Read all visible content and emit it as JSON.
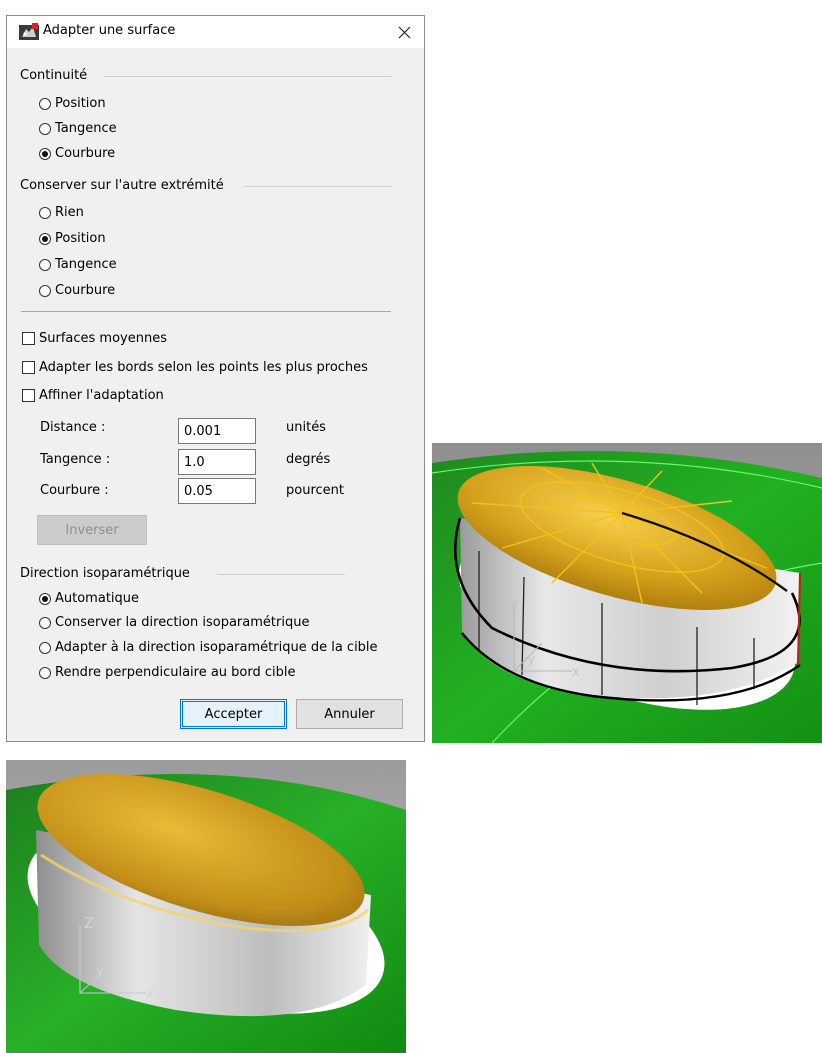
{
  "dialog": {
    "title": "Adapter une surface",
    "icon": "rhino-icon",
    "close_icon": "close-icon",
    "continuity": {
      "label": "Continuité",
      "options": [
        {
          "label": "Position",
          "selected": false
        },
        {
          "label": "Tangence",
          "selected": false
        },
        {
          "label": "Courbure",
          "selected": true
        }
      ]
    },
    "preserve": {
      "label": "Conserver sur l'autre extrémité",
      "options": [
        {
          "label": "Rien",
          "selected": false
        },
        {
          "label": "Position",
          "selected": true
        },
        {
          "label": "Tangence",
          "selected": false
        },
        {
          "label": "Courbure",
          "selected": false
        }
      ]
    },
    "checkboxes": [
      {
        "label": "Surfaces moyennes",
        "checked": false
      },
      {
        "label": "Adapter les bords selon les points les plus proches",
        "checked": false
      },
      {
        "label": "Affiner l'adaptation",
        "checked": false
      }
    ],
    "fields": [
      {
        "label": "Distance :",
        "value": "0.001",
        "unit": "unités"
      },
      {
        "label": "Tangence :",
        "value": "1.0",
        "unit": "degrés"
      },
      {
        "label": "Courbure :",
        "value": "0.05",
        "unit": "pourcent"
      }
    ],
    "invert_button": "Inverser",
    "isocurve": {
      "label": "Direction isoparamétrique",
      "options": [
        {
          "label": "Automatique",
          "selected": true
        },
        {
          "label": "Conserver la direction isoparamétrique",
          "selected": false
        },
        {
          "label": "Adapter à la direction isoparamétrique de la cible",
          "selected": false
        },
        {
          "label": "Rendre perpendiculaire au bord cible",
          "selected": false
        }
      ]
    },
    "accept_button": "Accepter",
    "cancel_button": "Annuler"
  },
  "viewports": [
    {
      "axis_labels": [
        "Z",
        "y",
        "x"
      ],
      "style": "shaded-with-isocurves"
    },
    {
      "axis_labels": [
        "Z",
        "y",
        "x"
      ],
      "style": "rendered"
    }
  ],
  "colors": {
    "dialog_bg": "#f0f0f0",
    "accent": "#0078d7",
    "green_surface": "#1aa51a",
    "gold_surface": "#d9a520",
    "isocurve": "#f0c000"
  }
}
